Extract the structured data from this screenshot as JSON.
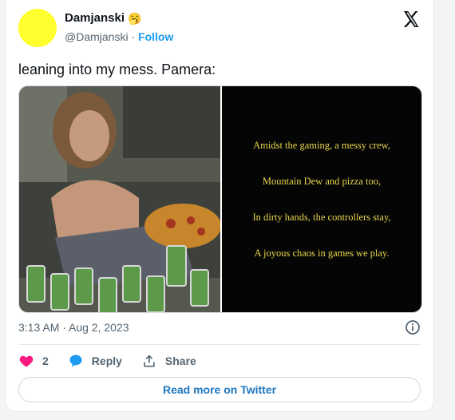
{
  "author": {
    "display_name": "Damjanski",
    "emoji": "🥱",
    "handle": "@Damjanski",
    "separator": "·",
    "follow_label": "Follow"
  },
  "tweet": {
    "text": "leaning into my mess. Pamera:",
    "timestamp": "3:13 AM · Aug 2, 2023"
  },
  "poem": [
    "Amidst the gaming, a messy crew,",
    "Mountain Dew and pizza too,",
    "In dirty hands, the controllers stay,",
    "A joyous chaos in games we play."
  ],
  "actions": {
    "likes": "2",
    "reply_label": "Reply",
    "share_label": "Share"
  },
  "read_more_label": "Read more on Twitter",
  "colors": {
    "avatar": "#ffff2e",
    "accent": "#1d9bf0",
    "like": "#f91880",
    "poem_text": "#e8d54a"
  },
  "icons": [
    "x-logo-icon",
    "info-icon",
    "heart-icon",
    "reply-bubble-icon",
    "share-icon"
  ]
}
